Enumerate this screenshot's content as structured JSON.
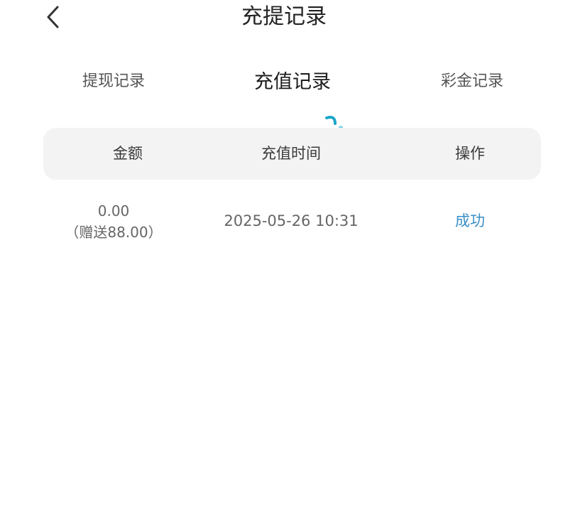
{
  "header": {
    "title": "充提记录"
  },
  "tabs": [
    {
      "label": "提现记录",
      "active": false
    },
    {
      "label": "充值记录",
      "active": true
    },
    {
      "label": "彩金记录",
      "active": false
    }
  ],
  "table": {
    "columns": [
      "金额",
      "充值时间",
      "操作"
    ],
    "rows": [
      {
        "amount": "0.00",
        "bonus": "（赠送88.00）",
        "time": "2025-05-26 10:31",
        "status": "成功"
      }
    ]
  },
  "colors": {
    "accent": "#1aa6c9",
    "status_success": "#3a8fc7",
    "header_bg": "#f3f3f3"
  },
  "icons": {
    "back": "chevron-left-icon",
    "tab_indicator": "swoosh-indicator-icon"
  }
}
